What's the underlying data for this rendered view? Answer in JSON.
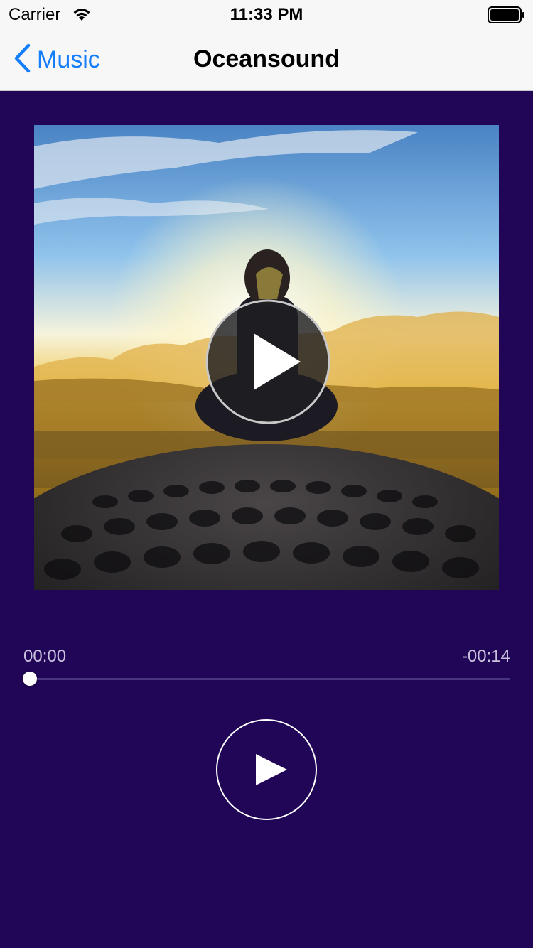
{
  "status_bar": {
    "carrier": "Carrier",
    "time": "11:33 PM",
    "icons": [
      "wifi-icon",
      "battery-icon"
    ]
  },
  "nav": {
    "back_label": "Music",
    "back_icon": "chevron-left-icon",
    "title": "Oceansound"
  },
  "artwork": {
    "description_icon": "album-artwork",
    "overlay_icon": "play-circle-icon"
  },
  "player": {
    "elapsed": "00:00",
    "remaining": "-00:14",
    "progress": 0.0,
    "play_icon": "play-icon"
  },
  "colors": {
    "background": "#210557",
    "accent": "#157efb",
    "bar": "#f7f7f7"
  }
}
